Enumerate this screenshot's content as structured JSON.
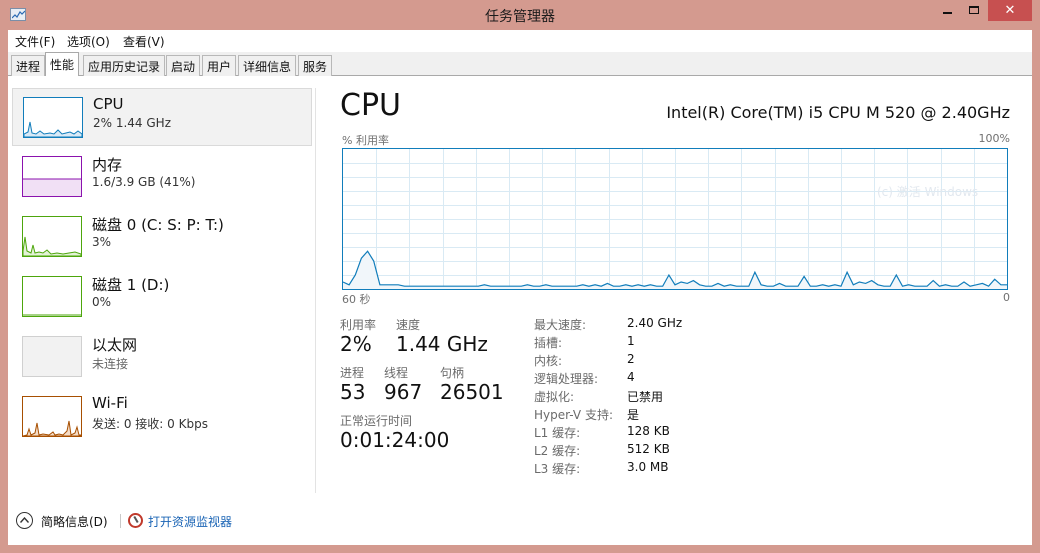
{
  "window": {
    "title": "任务管理器"
  },
  "menu": [
    "文件(F)",
    "选项(O)",
    "查看(V)"
  ],
  "tabs": [
    {
      "label": "进程",
      "active": false
    },
    {
      "label": "性能",
      "active": true
    },
    {
      "label": "应用历史记录",
      "active": false
    },
    {
      "label": "启动",
      "active": false
    },
    {
      "label": "用户",
      "active": false
    },
    {
      "label": "详细信息",
      "active": false
    },
    {
      "label": "服务",
      "active": false
    }
  ],
  "resources": [
    {
      "name": "CPU",
      "sub": "2% 1.44 GHz",
      "color": "#117dbb",
      "selected": true
    },
    {
      "name": "内存",
      "sub": "1.6/3.9 GB (41%)",
      "color": "#8b12ae",
      "selected": false
    },
    {
      "name": "磁盘 0 (C: S: P: T:)",
      "sub": "3%",
      "color": "#4da60c",
      "selected": false
    },
    {
      "name": "磁盘 1 (D:)",
      "sub": "0%",
      "color": "#4da60c",
      "selected": false
    },
    {
      "name": "以太网",
      "sub": "未连接",
      "color": "#bdbdbd",
      "selected": false
    },
    {
      "name": "Wi-Fi",
      "sub": "发送: 0 接收: 0 Kbps",
      "color": "#a74f01",
      "selected": false
    }
  ],
  "detail": {
    "title": "CPU",
    "model": "Intel(R) Core(TM) i5 CPU M 520 @ 2.40GHz",
    "graph_label": "% 利用率",
    "graph_max": "100%",
    "axis_left": "60 秒",
    "axis_right": "0",
    "watermark": "(c) 激活 Windows",
    "stats": {
      "util_label": "利用率",
      "util_value": "2%",
      "speed_label": "速度",
      "speed_value": "1.44 GHz",
      "proc_label": "进程",
      "proc_value": "53",
      "thread_label": "线程",
      "thread_value": "967",
      "handle_label": "句柄",
      "handle_value": "26501",
      "uptime_label": "正常运行时间",
      "uptime_value": "0:01:24:00"
    },
    "specs": [
      {
        "label": "最大速度:",
        "value": "2.40 GHz"
      },
      {
        "label": "插槽:",
        "value": "1"
      },
      {
        "label": "内核:",
        "value": "2"
      },
      {
        "label": "逻辑处理器:",
        "value": "4"
      },
      {
        "label": "虚拟化:",
        "value": "已禁用"
      },
      {
        "label": "Hyper-V 支持:",
        "value": "是"
      },
      {
        "label": "L1 缓存:",
        "value": "128 KB"
      },
      {
        "label": "L2 缓存:",
        "value": "512 KB"
      },
      {
        "label": "L3 缓存:",
        "value": "3.0 MB"
      }
    ],
    "cpu_history_percent": [
      5,
      3,
      10,
      22,
      27,
      20,
      3,
      3,
      3,
      3,
      2,
      2,
      2,
      2,
      2,
      2,
      2,
      2,
      2,
      2,
      2,
      2,
      2,
      3,
      2,
      2,
      2,
      2,
      2,
      2,
      3,
      2,
      2,
      3,
      2,
      2,
      2,
      2,
      2,
      3,
      2,
      3,
      2,
      4,
      2,
      2,
      3,
      2,
      3,
      2,
      3,
      2,
      2,
      10,
      3,
      5,
      4,
      6,
      3,
      2,
      2,
      4,
      2,
      3,
      2,
      2,
      2,
      12,
      3,
      2,
      2,
      4,
      2,
      2,
      2,
      9,
      2,
      2,
      3,
      2,
      3,
      2,
      12,
      3,
      5,
      4,
      6,
      3,
      2,
      2,
      10,
      2,
      3,
      2,
      2,
      2,
      6,
      2,
      3,
      2,
      2,
      5,
      2,
      3,
      4,
      2,
      7,
      3,
      3
    ]
  },
  "footer": {
    "fewer_details": "简略信息(D)",
    "open_monitor": "打开资源监视器"
  }
}
